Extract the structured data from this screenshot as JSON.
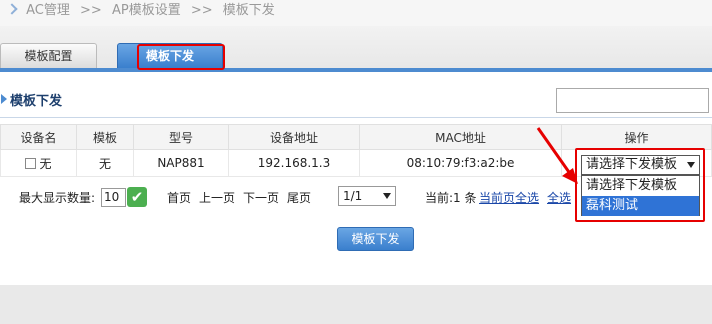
{
  "breadcrumb": {
    "items": [
      "AC管理",
      ">>",
      "AP模板设置",
      ">>",
      "模板下发"
    ]
  },
  "tabs": [
    {
      "label": "模板配置"
    },
    {
      "label": "模板下发"
    }
  ],
  "section": {
    "title": "模板下发",
    "search_value": ""
  },
  "table": {
    "headers": [
      "设备名",
      "模板",
      "型号",
      "设备地址",
      "MAC地址",
      "操作"
    ],
    "rows": [
      {
        "name": "无",
        "template": "无",
        "model": "NAP881",
        "address": "192.168.1.3",
        "mac": "08:10:79:f3:a2:be"
      }
    ]
  },
  "operation_select": {
    "selected": "请选择下发模板",
    "options": [
      "请选择下发模板",
      "磊科测试"
    ],
    "highlighted_index": 1
  },
  "pager": {
    "max_label": "最大显示数量:",
    "max_value": "10",
    "first": "首页",
    "prev": "上一页",
    "next": "下一页",
    "last": "尾页",
    "page_value": "1/1",
    "current_label": "当前:1 条",
    "select_page": "当前页全选",
    "select_all": "全选"
  },
  "action": {
    "deploy_button": "模板下发"
  },
  "colors": {
    "accent": "#3a7fcd",
    "highlight": "#e60000"
  }
}
